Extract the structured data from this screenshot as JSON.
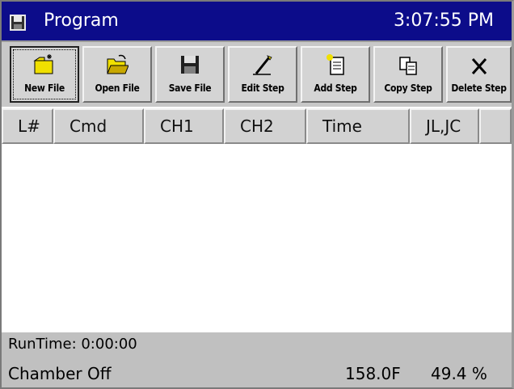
{
  "window": {
    "title": "Program",
    "clock": "3:07:55 PM"
  },
  "toolbar": {
    "buttons": [
      {
        "label": "New File",
        "icon": "new-file-icon"
      },
      {
        "label": "Open File",
        "icon": "open-folder-icon"
      },
      {
        "label": "Save File",
        "icon": "floppy-disk-icon"
      },
      {
        "label": "Edit Step",
        "icon": "pencil-icon"
      },
      {
        "label": "Add Step",
        "icon": "add-document-icon"
      },
      {
        "label": "Copy Step",
        "icon": "copy-icon"
      },
      {
        "label": "Delete Step",
        "icon": "x-delete-icon"
      }
    ]
  },
  "table": {
    "columns": [
      "L#",
      "Cmd",
      "CH1",
      "CH2",
      "Time",
      "JL,JC",
      ""
    ]
  },
  "status": {
    "runtime": "RunTime: 0:00:00",
    "chamber": "Chamber Off",
    "temperature": "158.0F",
    "humidity": "49.4 %"
  },
  "colors": {
    "title_bar": "#0c0c8a",
    "toolbar": "#c8c8c8",
    "status_bar": "#c0c0c0"
  }
}
